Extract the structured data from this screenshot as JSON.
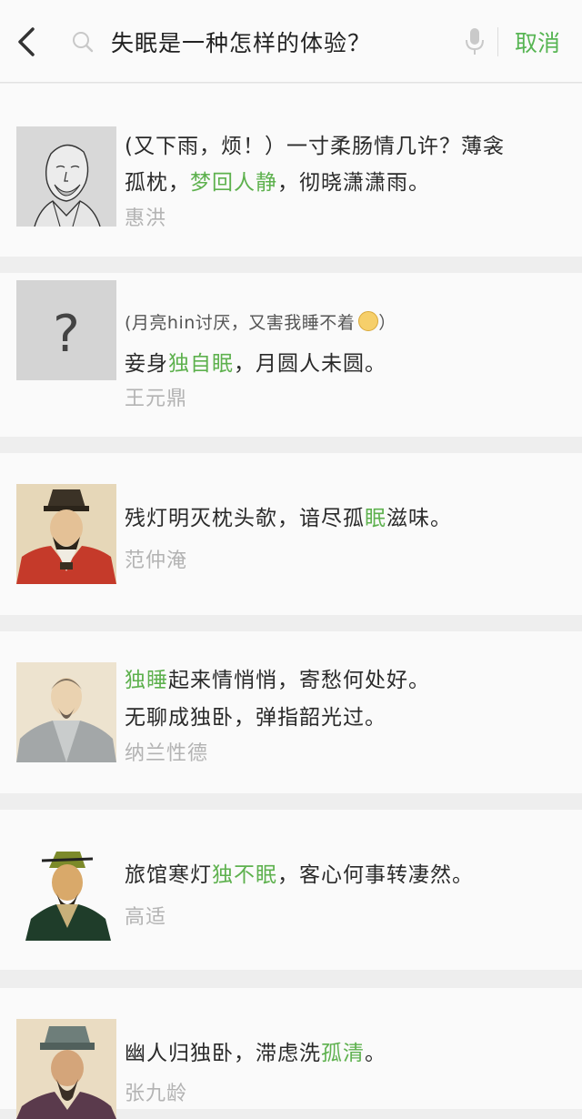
{
  "header": {
    "back_icon": "chevron-left-icon",
    "search_icon": "search-icon",
    "query": "失眠是一种怎样的体验？",
    "mic_icon": "microphone-icon",
    "cancel_label": "取消"
  },
  "colors": {
    "accent": "#5eb14e",
    "author": "#b3b3b3",
    "text": "#2a2a2a",
    "background": "#eeeeee",
    "card": "#fafafa"
  },
  "results": [
    {
      "thumb": "sketch-portrait",
      "lines": [
        [
          {
            "t": "(又下雨，烦！）一寸柔肠情几许？薄衾"
          }
        ],
        [
          {
            "t": "孤枕，"
          },
          {
            "t": "梦回人静",
            "hl": true
          },
          {
            "t": "，彻晓潇潇雨。"
          }
        ]
      ],
      "author": "惠洪"
    },
    {
      "thumb": "question-mark",
      "thumb_text": "?",
      "lines": [
        [
          {
            "t": "(月亮hin讨厌，又害我睡不着"
          },
          {
            "emoji": "tired-face-emoji"
          },
          {
            "t": "）"
          }
        ],
        [
          {
            "t": "妾身"
          },
          {
            "t": "独自眠",
            "hl": true
          },
          {
            "t": "，月圆人未圆。"
          }
        ]
      ],
      "author": "王元鼎"
    },
    {
      "thumb": "red-robe-portrait",
      "lines": [
        [
          {
            "t": "残灯明灭枕头欹，谙尽孤"
          },
          {
            "t": "眠",
            "hl": true
          },
          {
            "t": "滋味。"
          }
        ]
      ],
      "author": "范仲淹"
    },
    {
      "thumb": "grey-robe-portrait",
      "lines": [
        [
          {
            "t": "独睡",
            "hl": true
          },
          {
            "t": "起来情悄悄，寄愁何处好。"
          }
        ],
        [
          {
            "t": "无聊成独卧，弹指韶光过。"
          }
        ]
      ],
      "author": "纳兰性德"
    },
    {
      "thumb": "green-robe-portrait",
      "lines": [
        [
          {
            "t": "旅馆寒灯"
          },
          {
            "t": "独不眠",
            "hl": true
          },
          {
            "t": "，客心何事转凄然。"
          }
        ]
      ],
      "author": "高适"
    },
    {
      "thumb": "hat-portrait",
      "lines": [
        [
          {
            "t": "幽人归独卧，滞虑洗"
          },
          {
            "t": "孤清",
            "hl": true
          },
          {
            "t": "。"
          }
        ]
      ],
      "author": "张九龄"
    }
  ]
}
